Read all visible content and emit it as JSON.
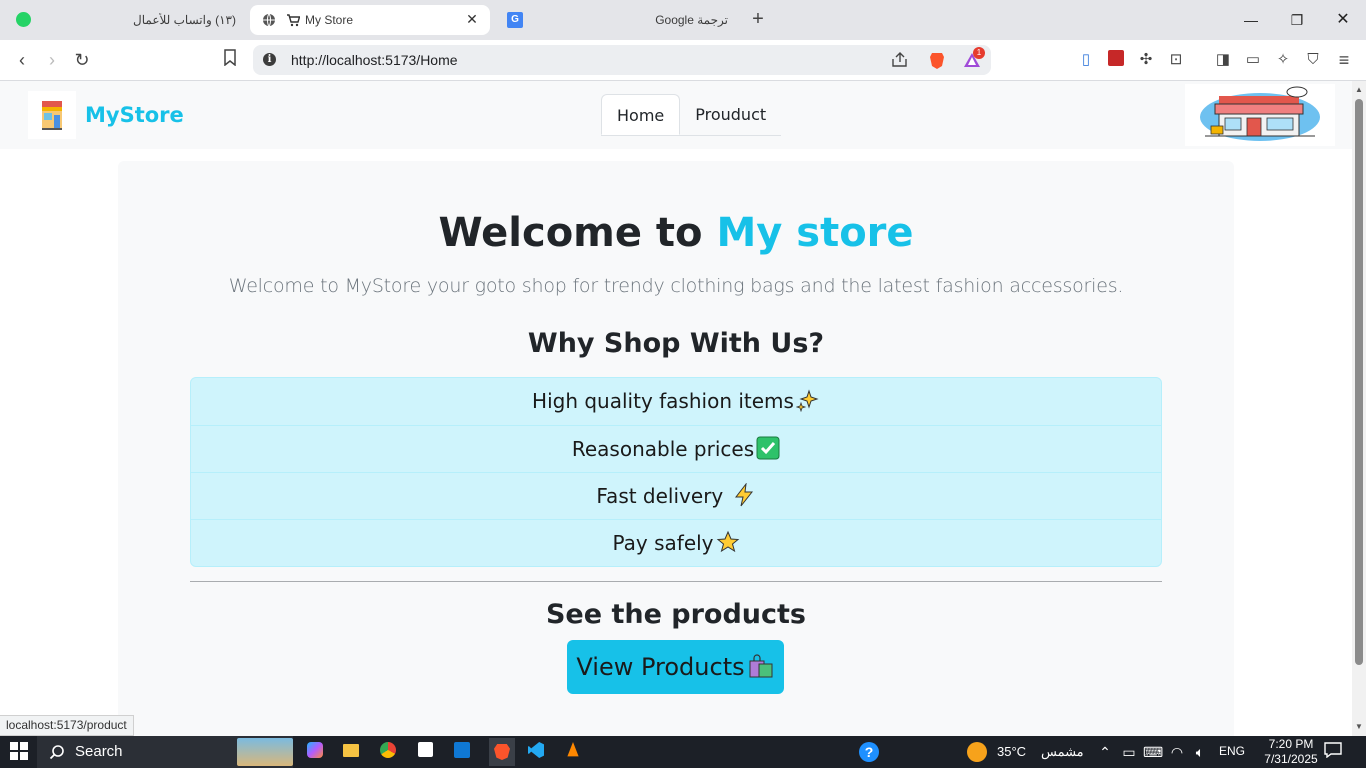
{
  "browser": {
    "tabs": [
      {
        "title": "(١٣) واتساب للأعمال",
        "active": false
      },
      {
        "title": "My Store",
        "active": true
      },
      {
        "title": "ترجمة Google",
        "active": false
      }
    ],
    "url": "http://localhost:5173/Home",
    "status_url": "localhost:5173/product",
    "badge_count": "1"
  },
  "site": {
    "brand": "MyStore",
    "nav": [
      {
        "label": "Home",
        "active": true
      },
      {
        "label": "Prouduct",
        "active": false
      }
    ],
    "hero": {
      "title_prefix": "Welcome to ",
      "title_accent": "My store",
      "lead": "Welcome to MyStore your goto shop for trendy clothing bags and the latest fashion accessories."
    },
    "why_title": "Why Shop With Us?",
    "features": [
      {
        "text": "High quality fashion items",
        "emoji": "sparkles-icon"
      },
      {
        "text": "Reasonable prices",
        "emoji": "check-mark-icon"
      },
      {
        "text": "Fast delivery ",
        "emoji": "lightning-icon"
      },
      {
        "text": "Pay safely",
        "emoji": "star-icon"
      }
    ],
    "see_title": "See the products",
    "view_button": "View Products",
    "accent_color": "#17c1e8"
  },
  "taskbar": {
    "search_label": "Search",
    "weather_temp": "35°C",
    "weather_desc": "مشمس",
    "lang": "ENG",
    "time": "7:20 PM",
    "date": "7/31/2025"
  }
}
